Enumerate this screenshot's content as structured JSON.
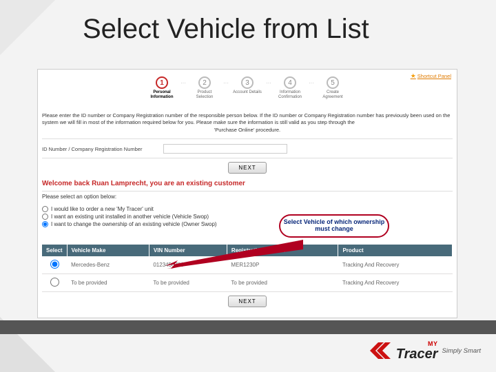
{
  "slide_title": "Select Vehicle from List",
  "shortcut": {
    "label": "Shortcut Panel"
  },
  "steps": [
    {
      "num": "1",
      "label": "Personal Information",
      "active": true
    },
    {
      "num": "2",
      "label": "Product Selection",
      "active": false
    },
    {
      "num": "3",
      "label": "Account Details",
      "active": false
    },
    {
      "num": "4",
      "label": "Information Confirmation",
      "active": false
    },
    {
      "num": "5",
      "label": "Create Agreement",
      "active": false
    }
  ],
  "instruction": "Please enter the ID number or Company Registration number of the responsible person below. If the ID number or Company Registration number has previously been used on the system we will fill in most of the information required below for you. Please make sure the information is still valid as you step through the",
  "instruction2": "'Purchase Online' procedure.",
  "id_field": {
    "label": "ID Number / Company Registration Number"
  },
  "next_label": "NEXT",
  "welcome": "Welcome back Ruan Lamprecht, you are an existing customer",
  "select_prompt": "Please select an option below:",
  "options": [
    "I would like to order a new 'My Tracer' unit",
    "I want an existing unit installed in another vehicle (Vehicle Swop)",
    "I want to change the ownership of an existing vehicle (Owner Swop)"
  ],
  "selected_option_index": 2,
  "callout": "Select Vehicle of which ownership must change",
  "table": {
    "headers": [
      "Select",
      "Vehicle Make",
      "VIN Number",
      "Registration Number",
      "Product"
    ],
    "rows": [
      {
        "selected": true,
        "make": "Mercedes-Benz",
        "vin": "0123456789",
        "reg": "MER1230P",
        "product": "Tracking And Recovery"
      },
      {
        "selected": false,
        "make": "To be provided",
        "vin": "To be provided",
        "reg": "To be provided",
        "product": "Tracking And Recovery"
      }
    ]
  },
  "logo": {
    "my": "MY",
    "brand": "Tracer",
    "tag": "Simply Smart"
  }
}
